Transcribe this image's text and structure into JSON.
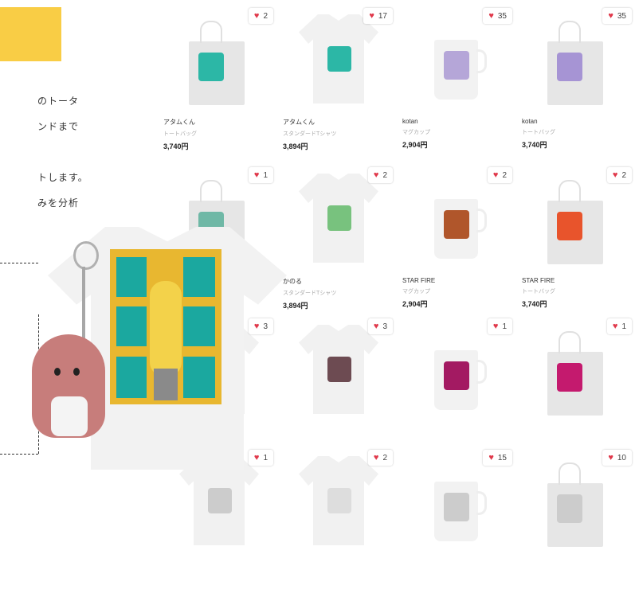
{
  "intro": {
    "lines": [
      "のトータ",
      "ンドまで",
      "トします。",
      "みを分析"
    ]
  },
  "colors": {
    "accent": "#f9cd45",
    "heart": "#e0394b"
  },
  "products": [
    {
      "favorites": "2",
      "name": "アタムくん",
      "type": "トートバッグ",
      "price": "3,740円",
      "kind": "tote-bag"
    },
    {
      "favorites": "17",
      "name": "アタムくん",
      "type": "スタンダードTシャツ",
      "price": "3,894円",
      "kind": "t-shirt"
    },
    {
      "favorites": "35",
      "name": "kotan",
      "type": "マグカップ",
      "price": "2,904円",
      "kind": "mug"
    },
    {
      "favorites": "35",
      "name": "kotan",
      "type": "トートバッグ",
      "price": "3,740円",
      "kind": "tote-bag"
    },
    {
      "favorites": "1",
      "name": "",
      "type": "",
      "price": "",
      "kind": "tote-bag"
    },
    {
      "favorites": "2",
      "name": "かのる",
      "type": "スタンダードTシャツ",
      "price": "3,894円",
      "kind": "t-shirt"
    },
    {
      "favorites": "2",
      "name": "STAR FIRE",
      "type": "マグカップ",
      "price": "2,904円",
      "kind": "mug"
    },
    {
      "favorites": "2",
      "name": "STAR FIRE",
      "type": "トートバッグ",
      "price": "3,740円",
      "kind": "tote-bag"
    },
    {
      "favorites": "3",
      "name": "",
      "type": "",
      "price": "",
      "kind": "t-shirt"
    },
    {
      "favorites": "3",
      "name": "",
      "type": "",
      "price": "",
      "kind": "t-shirt"
    },
    {
      "favorites": "1",
      "name": "",
      "type": "",
      "price": "",
      "kind": "mug"
    },
    {
      "favorites": "1",
      "name": "",
      "type": "",
      "price": "",
      "kind": "tote-bag"
    },
    {
      "favorites": "1",
      "name": "",
      "type": "",
      "price": "",
      "kind": "t-shirt"
    },
    {
      "favorites": "2",
      "name": "",
      "type": "",
      "price": "",
      "kind": "t-shirt"
    },
    {
      "favorites": "15",
      "name": "",
      "type": "",
      "price": "",
      "kind": "mug"
    },
    {
      "favorites": "10",
      "name": "",
      "type": "",
      "price": "",
      "kind": "tote-bag"
    }
  ],
  "heart_icon": "heart-icon"
}
